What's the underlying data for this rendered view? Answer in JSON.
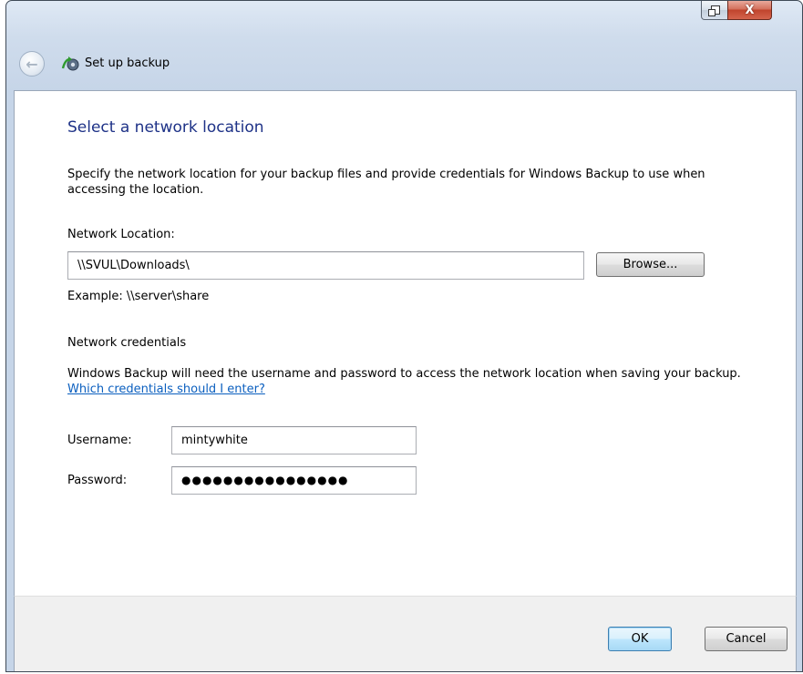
{
  "window": {
    "restore_icon": "restore-icon",
    "close_icon": "close-icon",
    "close_glyph": "X"
  },
  "nav": {
    "back_icon": "back-arrow-icon",
    "back_glyph": "←",
    "app_icon": "backup-icon",
    "title": "Set up backup"
  },
  "content": {
    "heading": "Select a network location",
    "description": "Specify the network location for your backup files and provide credentials for Windows Backup to use when accessing the location.",
    "network_location_label": "Network Location:",
    "network_location_value": "\\\\SVUL\\Downloads\\",
    "browse_label": "Browse...",
    "example": "Example: \\\\server\\share",
    "credentials_heading": "Network credentials",
    "credentials_description": "Windows Backup will need the username and password to access the network location when saving your backup.",
    "credentials_link": "Which credentials should I enter?",
    "username_label": "Username:",
    "username_value": "mintywhite",
    "password_label": "Password:",
    "password_value": "●●●●●●●●●●●●●●●●"
  },
  "footer": {
    "ok_label": "OK",
    "cancel_label": "Cancel"
  },
  "colors": {
    "heading": "#1e3287",
    "link": "#0b5fbf",
    "close_button": "#c0442d"
  }
}
